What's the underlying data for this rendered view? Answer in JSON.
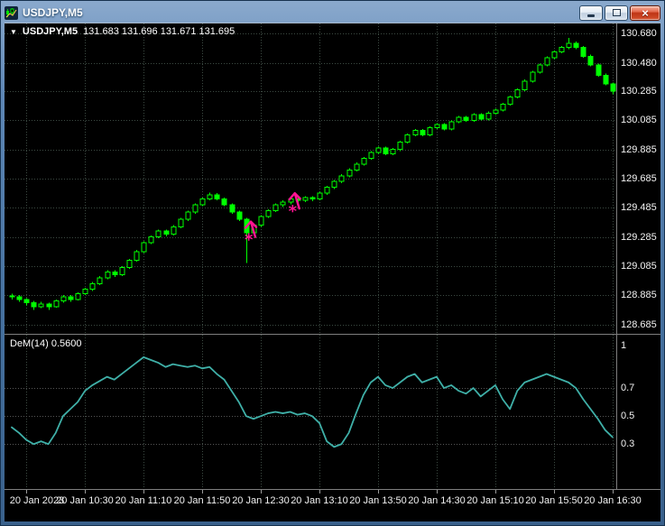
{
  "window": {
    "title": "USDJPY,M5",
    "close_glyph": "×"
  },
  "chart": {
    "dropdown_glyph": "▼",
    "symbol": "USDJPY,M5",
    "ohlc": "131.683 131.696 131.671 131.695",
    "indicator_label": "DeM(14) 0.5600"
  },
  "chart_data": {
    "type": "candlestick",
    "symbol": "USDJPY",
    "timeframe": "M5",
    "price_axis": {
      "max": 130.75,
      "min": 128.62,
      "gridlines": [
        130.68,
        130.48,
        130.285,
        130.085,
        129.885,
        129.685,
        129.485,
        129.285,
        129.085,
        128.885,
        128.685
      ],
      "labels": [
        "130.680",
        "130.480",
        "130.285",
        "130.085",
        "129.885",
        "129.685",
        "129.485",
        "129.285",
        "129.085",
        "128.885",
        "128.685"
      ]
    },
    "time_axis": {
      "labels": [
        "20 Jan 2023",
        "20 Jan 10:30",
        "20 Jan 11:10",
        "20 Jan 11:50",
        "20 Jan 12:30",
        "20 Jan 13:10",
        "20 Jan 13:50",
        "20 Jan 14:30",
        "20 Jan 15:10",
        "20 Jan 15:50",
        "20 Jan 16:30"
      ],
      "grid_bars": [
        2,
        10,
        18,
        26,
        34,
        42,
        50,
        58,
        66,
        74,
        82
      ]
    },
    "candles": [
      [
        128.88,
        128.895,
        128.855,
        128.875
      ],
      [
        128.875,
        128.885,
        128.84,
        128.855
      ],
      [
        128.855,
        128.865,
        128.815,
        128.835
      ],
      [
        128.835,
        128.845,
        128.785,
        128.805
      ],
      [
        128.805,
        128.84,
        128.795,
        128.825
      ],
      [
        128.825,
        128.835,
        128.785,
        128.805
      ],
      [
        128.805,
        128.855,
        128.8,
        128.845
      ],
      [
        128.845,
        128.885,
        128.835,
        128.875
      ],
      [
        128.875,
        128.885,
        128.84,
        128.855
      ],
      [
        128.855,
        128.905,
        128.85,
        128.895
      ],
      [
        128.895,
        128.935,
        128.885,
        128.925
      ],
      [
        128.925,
        128.975,
        128.915,
        128.965
      ],
      [
        128.965,
        129.015,
        128.955,
        129.005
      ],
      [
        129.005,
        129.055,
        128.995,
        129.045
      ],
      [
        129.045,
        129.055,
        129.01,
        129.025
      ],
      [
        129.025,
        129.085,
        129.015,
        129.075
      ],
      [
        129.075,
        129.135,
        129.065,
        129.125
      ],
      [
        129.125,
        129.195,
        129.115,
        129.185
      ],
      [
        129.185,
        129.255,
        129.175,
        129.245
      ],
      [
        129.245,
        129.295,
        129.235,
        129.285
      ],
      [
        129.285,
        129.335,
        129.275,
        129.325
      ],
      [
        129.325,
        129.335,
        129.29,
        129.305
      ],
      [
        129.305,
        129.365,
        129.295,
        129.355
      ],
      [
        129.355,
        129.415,
        129.345,
        129.405
      ],
      [
        129.405,
        129.465,
        129.395,
        129.455
      ],
      [
        129.455,
        129.515,
        129.445,
        129.505
      ],
      [
        129.505,
        129.555,
        129.495,
        129.545
      ],
      [
        129.545,
        129.59,
        129.535,
        129.575
      ],
      [
        129.575,
        129.585,
        129.535,
        129.545
      ],
      [
        129.545,
        129.555,
        129.495,
        129.505
      ],
      [
        129.505,
        129.515,
        129.445,
        129.455
      ],
      [
        129.455,
        129.465,
        129.395,
        129.405
      ],
      [
        129.405,
        129.415,
        129.105,
        129.315
      ],
      [
        129.315,
        129.375,
        129.305,
        129.365
      ],
      [
        129.365,
        129.435,
        129.355,
        129.425
      ],
      [
        129.425,
        129.475,
        129.415,
        129.465
      ],
      [
        129.465,
        129.515,
        129.455,
        129.505
      ],
      [
        129.505,
        129.535,
        129.49,
        129.525
      ],
      [
        129.525,
        129.555,
        129.51,
        129.545
      ],
      [
        129.545,
        129.555,
        129.52,
        129.535
      ],
      [
        129.535,
        129.565,
        129.525,
        129.555
      ],
      [
        129.555,
        129.565,
        129.53,
        129.545
      ],
      [
        129.545,
        129.595,
        129.535,
        129.585
      ],
      [
        129.585,
        129.635,
        129.575,
        129.625
      ],
      [
        129.625,
        129.675,
        129.615,
        129.665
      ],
      [
        129.665,
        129.715,
        129.655,
        129.705
      ],
      [
        129.705,
        129.755,
        129.695,
        129.745
      ],
      [
        129.745,
        129.795,
        129.735,
        129.785
      ],
      [
        129.785,
        129.835,
        129.775,
        129.825
      ],
      [
        129.825,
        129.875,
        129.815,
        129.865
      ],
      [
        129.865,
        129.905,
        129.855,
        129.895
      ],
      [
        129.895,
        129.905,
        129.845,
        129.855
      ],
      [
        129.855,
        129.895,
        129.845,
        129.885
      ],
      [
        129.885,
        129.945,
        129.875,
        129.935
      ],
      [
        129.935,
        129.995,
        129.925,
        129.985
      ],
      [
        129.985,
        130.025,
        129.975,
        130.015
      ],
      [
        130.015,
        130.025,
        129.975,
        129.985
      ],
      [
        129.985,
        130.045,
        129.975,
        130.035
      ],
      [
        130.035,
        130.065,
        130.025,
        130.055
      ],
      [
        130.055,
        130.065,
        130.015,
        130.025
      ],
      [
        130.025,
        130.085,
        130.015,
        130.075
      ],
      [
        130.075,
        130.115,
        130.065,
        130.105
      ],
      [
        130.105,
        130.115,
        130.075,
        130.085
      ],
      [
        130.085,
        130.135,
        130.075,
        130.125
      ],
      [
        130.125,
        130.135,
        130.085,
        130.095
      ],
      [
        130.095,
        130.145,
        130.085,
        130.135
      ],
      [
        130.135,
        130.165,
        130.125,
        130.155
      ],
      [
        130.155,
        130.205,
        130.145,
        130.195
      ],
      [
        130.195,
        130.255,
        130.185,
        130.245
      ],
      [
        130.245,
        130.305,
        130.235,
        130.295
      ],
      [
        130.295,
        130.365,
        130.285,
        130.355
      ],
      [
        130.355,
        130.425,
        130.345,
        130.415
      ],
      [
        130.415,
        130.475,
        130.405,
        130.465
      ],
      [
        130.465,
        130.525,
        130.455,
        130.515
      ],
      [
        130.515,
        130.565,
        130.505,
        130.555
      ],
      [
        130.555,
        130.595,
        130.545,
        130.585
      ],
      [
        130.585,
        130.65,
        130.575,
        130.615
      ],
      [
        130.615,
        130.625,
        130.575,
        130.585
      ],
      [
        130.585,
        130.595,
        130.515,
        130.525
      ],
      [
        130.525,
        130.535,
        130.455,
        130.465
      ],
      [
        130.465,
        130.475,
        130.385,
        130.395
      ],
      [
        130.395,
        130.405,
        130.325,
        130.335
      ],
      [
        130.335,
        130.345,
        130.265,
        130.285
      ]
    ],
    "signals": [
      {
        "bar": 33,
        "price": 129.285,
        "type": "buy-arrow"
      },
      {
        "bar": 39,
        "price": 129.48,
        "type": "buy-arrow"
      }
    ],
    "indicator": {
      "name": "DeM(14)",
      "value_label": "0.5600",
      "values": [
        0.42,
        0.38,
        0.33,
        0.3,
        0.32,
        0.3,
        0.38,
        0.5,
        0.55,
        0.6,
        0.68,
        0.72,
        0.75,
        0.78,
        0.76,
        0.8,
        0.84,
        0.88,
        0.92,
        0.9,
        0.88,
        0.85,
        0.87,
        0.86,
        0.85,
        0.86,
        0.84,
        0.85,
        0.8,
        0.76,
        0.68,
        0.6,
        0.5,
        0.48,
        0.5,
        0.52,
        0.53,
        0.52,
        0.53,
        0.51,
        0.52,
        0.5,
        0.45,
        0.32,
        0.28,
        0.3,
        0.38,
        0.52,
        0.65,
        0.74,
        0.78,
        0.72,
        0.7,
        0.74,
        0.78,
        0.8,
        0.74,
        0.76,
        0.78,
        0.7,
        0.72,
        0.68,
        0.66,
        0.7,
        0.64,
        0.68,
        0.72,
        0.62,
        0.55,
        0.68,
        0.74,
        0.76,
        0.78,
        0.8,
        0.78,
        0.76,
        0.74,
        0.7,
        0.62,
        0.55,
        0.48,
        0.4,
        0.35
      ],
      "levels": [
        0.7,
        0.5,
        0.3
      ],
      "axis": {
        "max": 1.08,
        "min": -0.02,
        "ticks": [
          {
            "v": 1.0,
            "label": "1"
          },
          {
            "v": 0.7,
            "label": "0.7"
          },
          {
            "v": 0.5,
            "label": "0.5"
          },
          {
            "v": 0.3,
            "label": "0.3"
          }
        ]
      }
    },
    "colors": {
      "bg": "#000000",
      "up": "#00ff00",
      "down": "#00ff00",
      "grid": "#3c4a42",
      "level": "#555555",
      "indicator_line": "#3fb0a8",
      "signal": "#ff1493",
      "axis_text": "#f2f2f2",
      "separator": "#7e7e7e"
    }
  }
}
